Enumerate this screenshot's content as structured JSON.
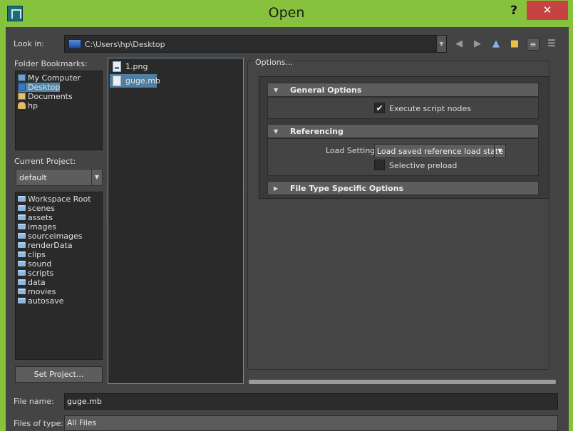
{
  "window": {
    "title": "Open",
    "help_label": "?",
    "close_label": "✕"
  },
  "look_in": {
    "label": "Look in:",
    "path": "C:\\Users\\hp\\Desktop"
  },
  "toolbar_icons": [
    "back-icon",
    "forward-icon",
    "up-icon",
    "new-folder-icon",
    "list-view-icon",
    "detail-view-icon"
  ],
  "bookmarks": {
    "label": "Folder Bookmarks:",
    "items": [
      {
        "label": "My Computer",
        "icon": "computer-icon"
      },
      {
        "label": "Desktop",
        "icon": "desktop-icon"
      },
      {
        "label": "Documents",
        "icon": "documents-icon"
      },
      {
        "label": "hp",
        "icon": "user-folder-icon"
      }
    ],
    "selected": "Desktop"
  },
  "project": {
    "label": "Current Project:",
    "value": "default",
    "folders": [
      "Workspace Root",
      "scenes",
      "assets",
      "images",
      "sourceimages",
      "renderData",
      "clips",
      "sound",
      "scripts",
      "data",
      "movies",
      "autosave"
    ],
    "set_button": "Set Project..."
  },
  "files": {
    "items": [
      "1.png",
      "guge.mb"
    ],
    "selected": "guge.mb"
  },
  "options": {
    "legend": "Options...",
    "general": {
      "title": "General Options",
      "execute_script_nodes": {
        "label": "Execute script nodes",
        "checked": true
      }
    },
    "referencing": {
      "title": "Referencing",
      "load_settings_label": "Load Settings",
      "load_settings_value": "Load saved reference load state",
      "selective_preload": {
        "label": "Selective preload",
        "checked": false
      }
    },
    "file_type": {
      "title": "File Type Specific Options"
    }
  },
  "file_name": {
    "label": "File name:",
    "value": "guge.mb"
  },
  "files_of_type": {
    "label": "Files of type:",
    "value": "All Files"
  },
  "colors": {
    "title_bar": "#86c23d",
    "close_button": "#c74343",
    "selection": "#5285a6",
    "panel_bg": "#444444",
    "field_bg": "#2a2a2a"
  }
}
